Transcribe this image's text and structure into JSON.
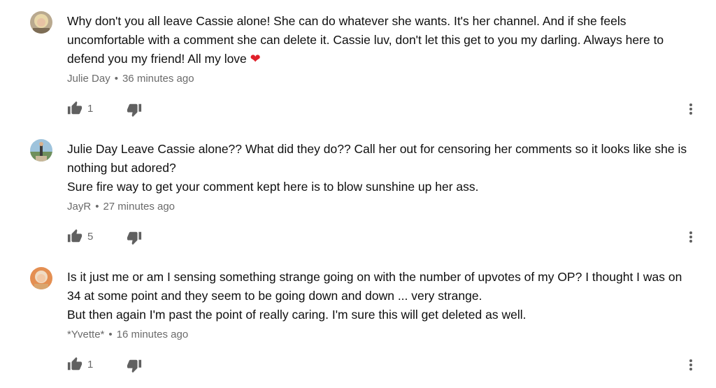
{
  "comments": [
    {
      "avatar_icon": "avatar-photo-blonde-woman",
      "text": "Why don't you all leave Cassie alone! She can do whatever she wants. It's her channel. And if she feels uncomfortable with a comment she can delete it. Cassie luv, don't let this get to you my darling. Always here to defend you my friend! All my love",
      "emoji": "❤",
      "author": "Julie Day",
      "separator": "•",
      "time": "36 minutes ago",
      "likes": "1",
      "like_icon": "thumbs-up-icon",
      "dislike_icon": "thumbs-down-icon",
      "more_icon": "more-vertical-icon"
    },
    {
      "avatar_icon": "avatar-photo-landscape",
      "text": "Julie Day  Leave Cassie alone?? What did they do?? Call her out for censoring her comments so it looks like she is nothing but adored?\nSure fire way to get your comment kept here is to blow sunshine up her ass.",
      "author": "JayR",
      "separator": "•",
      "time": "27 minutes ago",
      "likes": "5",
      "like_icon": "thumbs-up-icon",
      "dislike_icon": "thumbs-down-icon",
      "more_icon": "more-vertical-icon"
    },
    {
      "avatar_icon": "avatar-photo-woman",
      "text": "Is it just me or am I sensing something strange going on with the number of upvotes of my OP? I thought I was on 34 at some point and they seem to be going down and down  ... very strange.\nBut then again I'm past the point of really caring. I'm sure this will get deleted as well.",
      "author": "*Yvette*",
      "separator": "•",
      "time": "16 minutes ago",
      "likes": "1",
      "like_icon": "thumbs-up-icon",
      "dislike_icon": "thumbs-down-icon",
      "more_icon": "more-vertical-icon"
    }
  ],
  "colors": {
    "text": "#0f0f0f",
    "meta": "#6b6b6b",
    "icon": "#606060",
    "heart": "#e0202a"
  }
}
